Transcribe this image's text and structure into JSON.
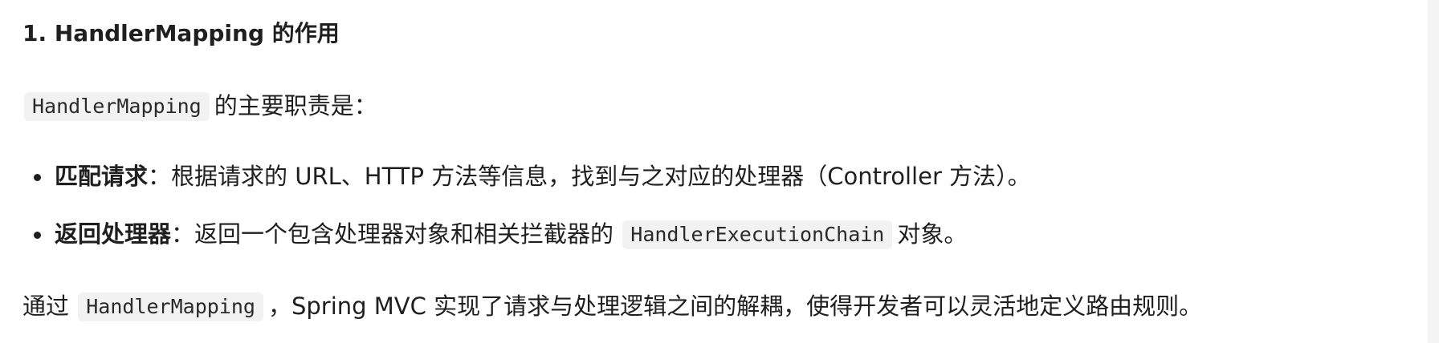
{
  "heading": {
    "text": "1. HandlerMapping 的作用"
  },
  "intro": {
    "code": "HandlerMapping",
    "text": "的主要职责是："
  },
  "bullets": [
    {
      "label": "匹配请求",
      "colon": "：",
      "text": "根据请求的 URL、HTTP 方法等信息，找到与之对应的处理器（Controller 方法）。"
    },
    {
      "label": "返回处理器",
      "colon": "：",
      "text_before": "返回一个包含处理器对象和相关拦截器的",
      "code": "HandlerExecutionChain",
      "text_after": "对象。"
    }
  ],
  "conclusion": {
    "text_before": "通过",
    "code": "HandlerMapping",
    "text_after": "，Spring MVC 实现了请求与处理逻辑之间的解耦，使得开发者可以灵活地定义路由规则。"
  }
}
